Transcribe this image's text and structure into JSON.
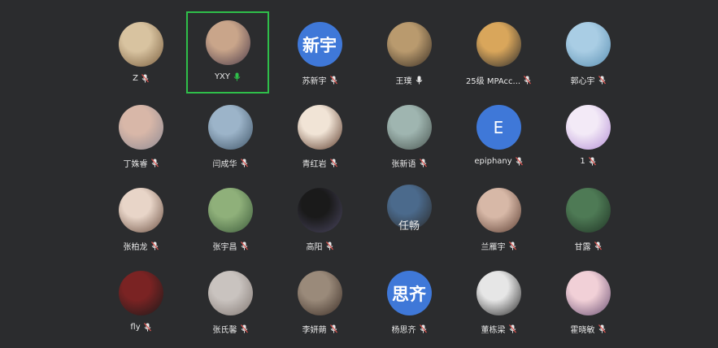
{
  "participants": [
    {
      "name": "Z",
      "avatar_type": "photo",
      "avatar_colors": [
        "#d8c3a0",
        "#7a5e3e"
      ],
      "mic": "muted",
      "active": false
    },
    {
      "name": "YXY",
      "avatar_type": "photo",
      "avatar_colors": [
        "#c9a58a",
        "#4d3c4a"
      ],
      "mic": "on",
      "active": true
    },
    {
      "name": "苏新宇",
      "avatar_type": "text",
      "avatar_text": "新宇",
      "mic": "muted",
      "active": false
    },
    {
      "name": "王璞",
      "avatar_type": "photo",
      "avatar_colors": [
        "#b99a6e",
        "#3a2f23"
      ],
      "mic": "off-white",
      "active": false
    },
    {
      "name": "25级 MPAcc...",
      "avatar_type": "photo",
      "avatar_colors": [
        "#d9a65b",
        "#2b2b2b"
      ],
      "mic": "muted",
      "active": false
    },
    {
      "name": "郭心宇",
      "avatar_type": "photo",
      "avatar_colors": [
        "#a9cde4",
        "#5a8fb2"
      ],
      "mic": "muted",
      "active": false
    },
    {
      "name": "丁姝睿",
      "avatar_type": "photo",
      "avatar_colors": [
        "#d8b7a8",
        "#8e8a94"
      ],
      "mic": "muted",
      "active": false
    },
    {
      "name": "闫成华",
      "avatar_type": "photo",
      "avatar_colors": [
        "#9cb4c9",
        "#3f5467"
      ],
      "mic": "muted",
      "active": false
    },
    {
      "name": "青红岩",
      "avatar_type": "photo",
      "avatar_colors": [
        "#f1e4d6",
        "#5b3a2a"
      ],
      "mic": "muted",
      "active": false
    },
    {
      "name": "张新语",
      "avatar_type": "photo",
      "avatar_colors": [
        "#9fb5b0",
        "#4a5651"
      ],
      "mic": "muted",
      "active": false
    },
    {
      "name": "epiphany",
      "avatar_type": "text",
      "avatar_text": "E",
      "mic": "muted",
      "active": false
    },
    {
      "name": "1",
      "avatar_type": "photo",
      "avatar_colors": [
        "#f3eaf7",
        "#b58fd6"
      ],
      "mic": "muted",
      "active": false
    },
    {
      "name": "张柏龙",
      "avatar_type": "photo",
      "avatar_colors": [
        "#e8d5c8",
        "#6b4f41"
      ],
      "mic": "muted",
      "active": false
    },
    {
      "name": "张宇昌",
      "avatar_type": "photo",
      "avatar_colors": [
        "#8fb07a",
        "#3b5a3a"
      ],
      "mic": "muted",
      "active": false
    },
    {
      "name": "高阳",
      "avatar_type": "photo",
      "avatar_colors": [
        "#1a1a1a",
        "#4a4660"
      ],
      "mic": "muted",
      "active": false
    },
    {
      "name": "任畅",
      "avatar_type": "photo",
      "avatar_colors": [
        "#4b6a8c",
        "#2a2a2a"
      ],
      "mic": "none",
      "active": false,
      "big_label": true
    },
    {
      "name": "兰雁宇",
      "avatar_type": "photo",
      "avatar_colors": [
        "#d7b8a7",
        "#5b3d31"
      ],
      "mic": "muted",
      "active": false
    },
    {
      "name": "甘露",
      "avatar_type": "photo",
      "avatar_colors": [
        "#4e7a55",
        "#1f3324"
      ],
      "mic": "muted",
      "active": false
    },
    {
      "name": "fly",
      "avatar_type": "photo",
      "avatar_colors": [
        "#7a2323",
        "#1a1a1a"
      ],
      "mic": "muted",
      "active": false
    },
    {
      "name": "张氏馨",
      "avatar_type": "photo",
      "avatar_colors": [
        "#c9c3bf",
        "#807671"
      ],
      "mic": "muted",
      "active": false
    },
    {
      "name": "李妍蒴",
      "avatar_type": "photo",
      "avatar_colors": [
        "#9a8a7a",
        "#3c2e26"
      ],
      "mic": "muted",
      "active": false
    },
    {
      "name": "杨思齐",
      "avatar_type": "text",
      "avatar_text": "思齐",
      "mic": "muted",
      "active": false
    },
    {
      "name": "董栋梁",
      "avatar_type": "photo",
      "avatar_colors": [
        "#e6e6e6",
        "#2a2a2a"
      ],
      "mic": "muted",
      "active": false
    },
    {
      "name": "霍晓敏",
      "avatar_type": "photo",
      "avatar_colors": [
        "#f1d0d7",
        "#6a4f73"
      ],
      "mic": "muted",
      "active": false
    }
  ],
  "colors": {
    "background": "#2b2c2e",
    "active_border": "#2fbf4a",
    "text_avatar": "#3f78d8",
    "muted_icon": "#e8e8e8",
    "muted_slash": "#d9534f",
    "mic_on": "#2fbf4a"
  }
}
